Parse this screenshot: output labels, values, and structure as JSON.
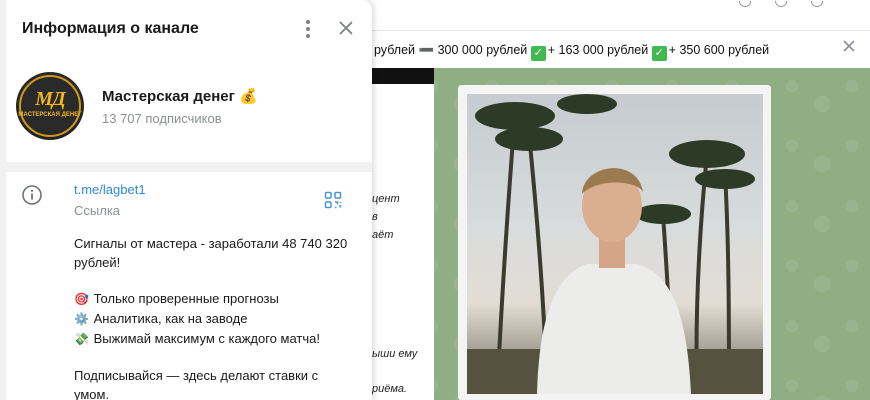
{
  "panel": {
    "title": "Информация о канале",
    "channel_name": "Мастерская денег",
    "channel_emoji": "💰",
    "subscribers": "13 707 подписчиков",
    "avatar_text": "МД",
    "avatar_sub": "МАСТЕРСКАЯ ДЕНЕГ",
    "link": "t.me/lagbet1",
    "link_label": "Ссылка",
    "description": {
      "line1": "Сигналы от мастера - заработали 48 740 320",
      "line2": "рублей!",
      "bullet1_icon": "🎯",
      "bullet1": "Только проверенные прогнозы",
      "bullet2_icon": "⚙️",
      "bullet2": "Аналитика, как на заводе",
      "bullet3_icon": "💸",
      "bullet3": "Выжимай максимум с каждого матча!",
      "line_sub1": "Подписывайся — здесь делают ставки с",
      "line_sub2": "умом."
    }
  },
  "pinned": {
    "text_a": "рублей ",
    "minus": "➖",
    "text_b": " 300 000 рублей ",
    "text_c": "+ 163 000 рублей ",
    "text_d": "+ 350 600 рублей ",
    "check": "✓"
  },
  "chat_fragments": {
    "f1": "цент",
    "f2": "в",
    "f3": "аёт",
    "f4": "ыши ему",
    "f5": "риёма."
  },
  "colors": {
    "accent": "#2f8bd5",
    "muted": "#8b8f94",
    "chat_bg": "#8fae84",
    "check_green": "#3fb950"
  }
}
